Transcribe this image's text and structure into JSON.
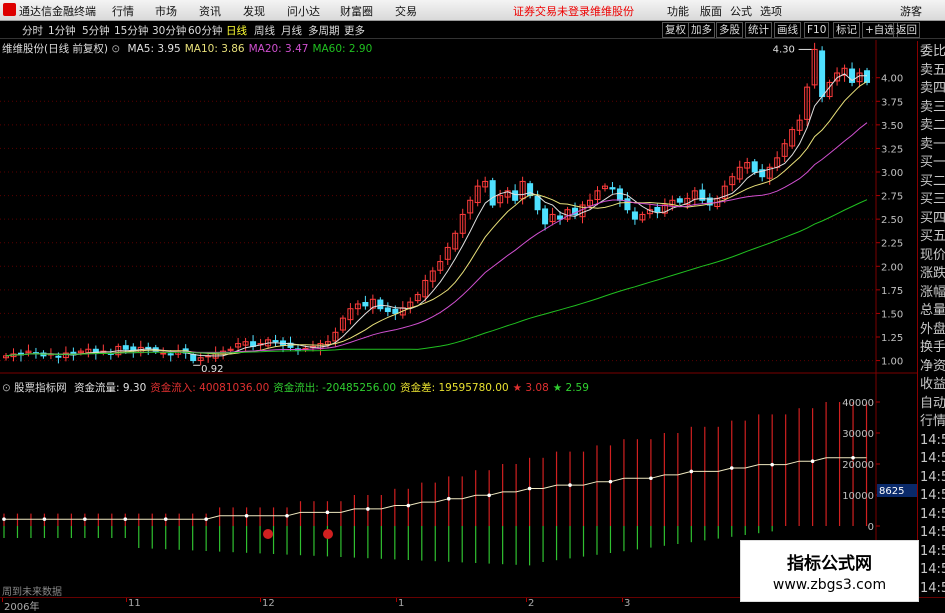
{
  "menubar": {
    "app_title": "通达信金融终端",
    "items": [
      "行情",
      "市场",
      "资讯",
      "发现",
      "问小达",
      "财富圈",
      "交易"
    ],
    "notice": "证券交易未登录",
    "stock": "维维股份",
    "right_items": [
      "功能",
      "版面",
      "公式",
      "选项"
    ],
    "user": "游客"
  },
  "toolbar": {
    "periods": [
      "分时",
      "1分钟",
      "5分钟",
      "15分钟",
      "30分钟",
      "60分钟",
      "日线",
      "周线",
      "月线",
      "多周期",
      "更多"
    ],
    "active_period": "日线",
    "right_buttons": [
      "复权",
      "加多",
      "多股",
      "统计",
      "画线",
      "F10",
      "标记",
      "+自选",
      "返回"
    ]
  },
  "main_chart": {
    "stock_label": "维维股份(日线 前复权)",
    "ma_labels": [
      {
        "text": "MA5: 3.95",
        "color": "#e0e0e0"
      },
      {
        "text": "MA10: 3.86",
        "color": "#e8e07a"
      },
      {
        "text": "MA20: 3.47",
        "color": "#d050d0"
      },
      {
        "text": "MA60: 2.90",
        "color": "#20c020"
      }
    ],
    "high_label": "4.30",
    "low_label": "0.92",
    "y_ticks": [
      "4.00",
      "3.75",
      "3.50",
      "3.25",
      "3.00",
      "2.75",
      "2.50",
      "2.25",
      "2.00",
      "1.75",
      "1.50",
      "1.25",
      "1.00"
    ]
  },
  "sub_chart": {
    "indicator_name": "股票指标网",
    "items": [
      {
        "text": "资金流量: 9.30",
        "color": "#e0e0e0"
      },
      {
        "text": "资金流入: 40081036.00",
        "color": "#e03030"
      },
      {
        "text": "资金流出: -20485256.00",
        "color": "#30d030"
      },
      {
        "text": "资金差: 19595780.00",
        "color": "#e8e030"
      },
      {
        "text": "★ 3.08",
        "color": "#e03030"
      },
      {
        "text": "★ 2.59",
        "color": "#30d030"
      }
    ],
    "y_ticks": [
      "40000",
      "30000",
      "20000",
      "10000",
      "0"
    ],
    "badge": "8625"
  },
  "right_panel": {
    "items": [
      "委比",
      "卖五",
      "卖四",
      "卖三",
      "卖二",
      "卖一",
      "买一",
      "买二",
      "买三",
      "买四",
      "买五",
      "现价",
      "涨跌",
      "涨幅",
      "总量",
      "外盘",
      "换手",
      "净资",
      "收益",
      "自动",
      "行情",
      "14:5",
      "14:5",
      "14:5",
      "14:5",
      "14:5",
      "14:5",
      "14:5",
      "14:5",
      "14:5"
    ]
  },
  "status_text": "周到未来数据",
  "date_axis": [
    "2006年",
    "11",
    "12",
    "1",
    "2",
    "3"
  ],
  "watermark": {
    "title": "指标公式网",
    "url": "www.zbgs3.com"
  },
  "colors": {
    "up": "#ff3c3c",
    "down": "#4fe0ff",
    "ma5": "#e0e0e0",
    "ma10": "#e8e07a",
    "ma20": "#d050d0",
    "ma60": "#20c020",
    "grid": "#5a0000"
  },
  "chart_data": {
    "type": "candlestick",
    "y_range": [
      0.9,
      4.4
    ],
    "closes": [
      1.05,
      1.07,
      1.06,
      1.1,
      1.08,
      1.05,
      1.07,
      1.04,
      1.08,
      1.06,
      1.1,
      1.12,
      1.08,
      1.1,
      1.07,
      1.15,
      1.12,
      1.1,
      1.14,
      1.12,
      1.1,
      1.08,
      1.06,
      1.1,
      1.08,
      1.0,
      1.03,
      1.05,
      1.08,
      1.1,
      1.12,
      1.18,
      1.2,
      1.15,
      1.18,
      1.22,
      1.2,
      1.16,
      1.14,
      1.12,
      1.13,
      1.15,
      1.18,
      1.2,
      1.3,
      1.45,
      1.55,
      1.6,
      1.58,
      1.65,
      1.55,
      1.52,
      1.5,
      1.56,
      1.62,
      1.7,
      1.85,
      1.95,
      2.05,
      2.2,
      2.35,
      2.55,
      2.7,
      2.85,
      2.9,
      2.65,
      2.75,
      2.8,
      2.7,
      2.9,
      2.75,
      2.6,
      2.45,
      2.55,
      2.5,
      2.6,
      2.55,
      2.65,
      2.7,
      2.8,
      2.85,
      2.82,
      2.7,
      2.6,
      2.5,
      2.55,
      2.6,
      2.58,
      2.65,
      2.7,
      2.68,
      2.72,
      2.8,
      2.7,
      2.65,
      2.72,
      2.85,
      2.95,
      3.05,
      3.1,
      3.0,
      2.95,
      3.05,
      3.15,
      3.3,
      3.45,
      3.55,
      3.9,
      4.3,
      3.8,
      3.95,
      4.05,
      4.1,
      3.95,
      4.05,
      3.95
    ],
    "ma60_end": 2.9,
    "flow_series": [
      2,
      2,
      2,
      2,
      2,
      2,
      2,
      2,
      2,
      2,
      2,
      2,
      2,
      2,
      2,
      2,
      3,
      3,
      3,
      3,
      3,
      3,
      4,
      4,
      4,
      4,
      5,
      5,
      5,
      6,
      6,
      7,
      7,
      8,
      8,
      9,
      9,
      10,
      10,
      11,
      11,
      12,
      12,
      12,
      13,
      13,
      14,
      14,
      14,
      15,
      15,
      16,
      16,
      16,
      17,
      17,
      18,
      18,
      18,
      19,
      19,
      20,
      20,
      20,
      20
    ]
  }
}
